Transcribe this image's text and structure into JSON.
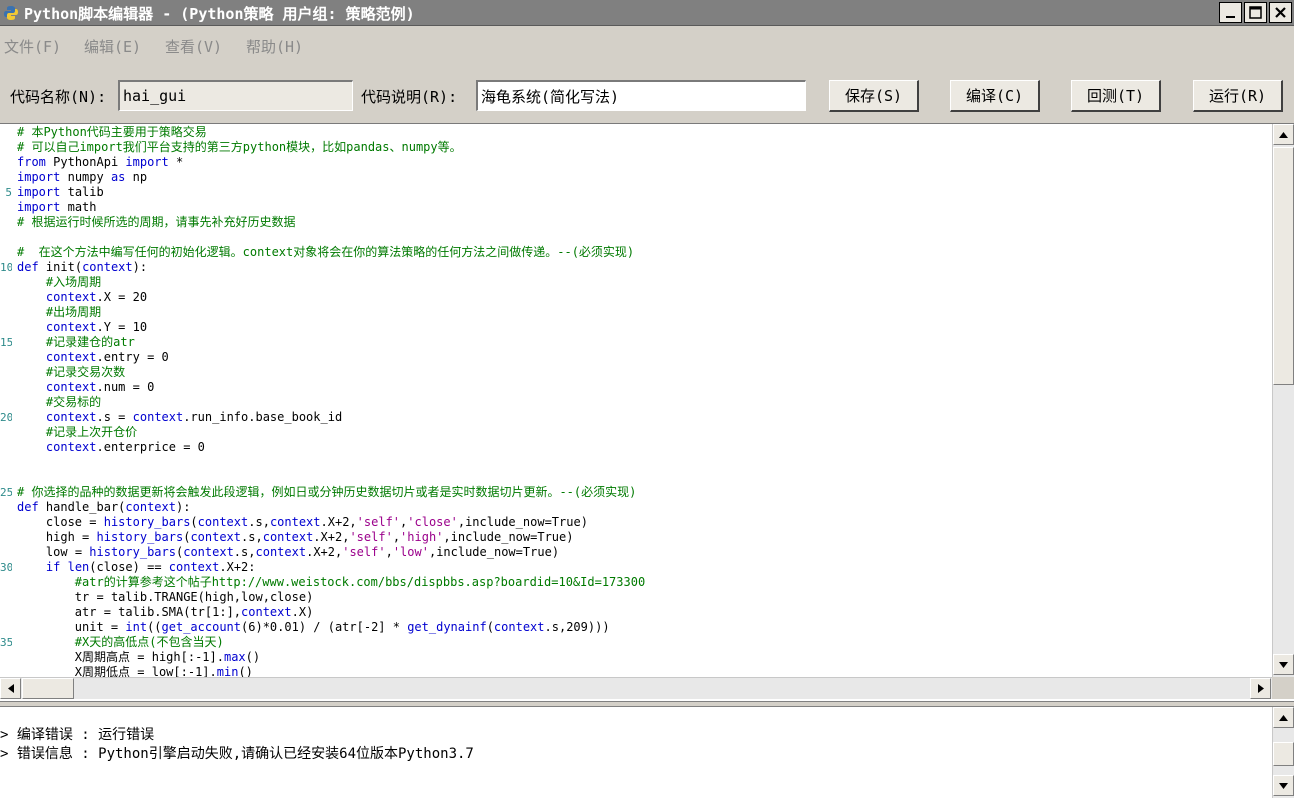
{
  "window": {
    "title": "Python脚本编辑器 - (Python策略 用户组: 策略范例)",
    "icon": "python-logo-icon",
    "controls": [
      "minimize-icon",
      "maximize-icon",
      "close-icon"
    ]
  },
  "menu": {
    "items": [
      {
        "label": "文件(F)"
      },
      {
        "label": "编辑(E)"
      },
      {
        "label": "查看(V)"
      },
      {
        "label": "帮助(H)"
      }
    ]
  },
  "toolbar": {
    "name_label": "代码名称(N):",
    "name_value": "hai_gui",
    "desc_label": "代码说明(R):",
    "desc_value": "海龟系统(简化写法)",
    "save_label": "保存(S)",
    "compile_label": "编译(C)",
    "backtest_label": "回测(T)",
    "run_label": "运行(R)"
  },
  "colors": {
    "comment": "#007a00",
    "keyword": "#0000d0",
    "string": "#9b008b",
    "line_number": "#2e8b8b"
  },
  "editor": {
    "lines": [
      {
        "n": "",
        "t": "# 本Python代码主要用于策略交易"
      },
      {
        "n": "",
        "t": "# 可以自己import我们平台支持的第三方python模块，比如pandas、numpy等。"
      },
      {
        "n": "",
        "t": "from PythonApi import *"
      },
      {
        "n": "",
        "t": "import numpy as np"
      },
      {
        "n": "5",
        "t": "import talib"
      },
      {
        "n": "",
        "t": "import math"
      },
      {
        "n": "",
        "t": "# 根据运行时候所选的周期，请事先补充好历史数据"
      },
      {
        "n": "",
        "t": ""
      },
      {
        "n": "",
        "t": "#  在这个方法中编写任何的初始化逻辑。context对象将会在你的算法策略的任何方法之间做传递。--(必须实现)"
      },
      {
        "n": "10",
        "t": "def init(context):"
      },
      {
        "n": "",
        "t": "    #入场周期"
      },
      {
        "n": "",
        "t": "    context.X = 20"
      },
      {
        "n": "",
        "t": "    #出场周期"
      },
      {
        "n": "",
        "t": "    context.Y = 10"
      },
      {
        "n": "15",
        "t": "    #记录建仓的atr"
      },
      {
        "n": "",
        "t": "    context.entry = 0"
      },
      {
        "n": "",
        "t": "    #记录交易次数"
      },
      {
        "n": "",
        "t": "    context.num = 0"
      },
      {
        "n": "",
        "t": "    #交易标的"
      },
      {
        "n": "20",
        "t": "    context.s = context.run_info.base_book_id"
      },
      {
        "n": "",
        "t": "    #记录上次开仓价"
      },
      {
        "n": "",
        "t": "    context.enterprice = 0"
      },
      {
        "n": "",
        "t": ""
      },
      {
        "n": "",
        "t": ""
      },
      {
        "n": "25",
        "t": "# 你选择的品种的数据更新将会触发此段逻辑，例如日或分钟历史数据切片或者是实时数据切片更新。--(必须实现)"
      },
      {
        "n": "",
        "t": "def handle_bar(context):"
      },
      {
        "n": "",
        "t": "    close = history_bars(context.s,context.X+2,'self','close',include_now=True)"
      },
      {
        "n": "",
        "t": "    high = history_bars(context.s,context.X+2,'self','high',include_now=True)"
      },
      {
        "n": "",
        "t": "    low = history_bars(context.s,context.X+2,'self','low',include_now=True)"
      },
      {
        "n": "30",
        "t": "    if len(close) == context.X+2:"
      },
      {
        "n": "",
        "t": "        #atr的计算参考这个帖子http://www.weistock.com/bbs/dispbbs.asp?boardid=10&Id=173300"
      },
      {
        "n": "",
        "t": "        tr = talib.TRANGE(high,low,close)"
      },
      {
        "n": "",
        "t": "        atr = talib.SMA(tr[1:],context.X)"
      },
      {
        "n": "",
        "t": "        unit = int((get_account(6)*0.01) / (atr[-2] * get_dynainf(context.s,209)))"
      },
      {
        "n": "35",
        "t": "        #X天的高低点(不包含当天)"
      },
      {
        "n": "",
        "t": "        X周期高点 = high[:-1].max()"
      },
      {
        "n": "",
        "t": "        X周期低点 = low[:-1].min()"
      }
    ]
  },
  "output": {
    "lines": [
      "编译错误 : 运行错误",
      "错误信息 : Python引擎启动失败,请确认已经安装64位版本Python3.7"
    ]
  }
}
